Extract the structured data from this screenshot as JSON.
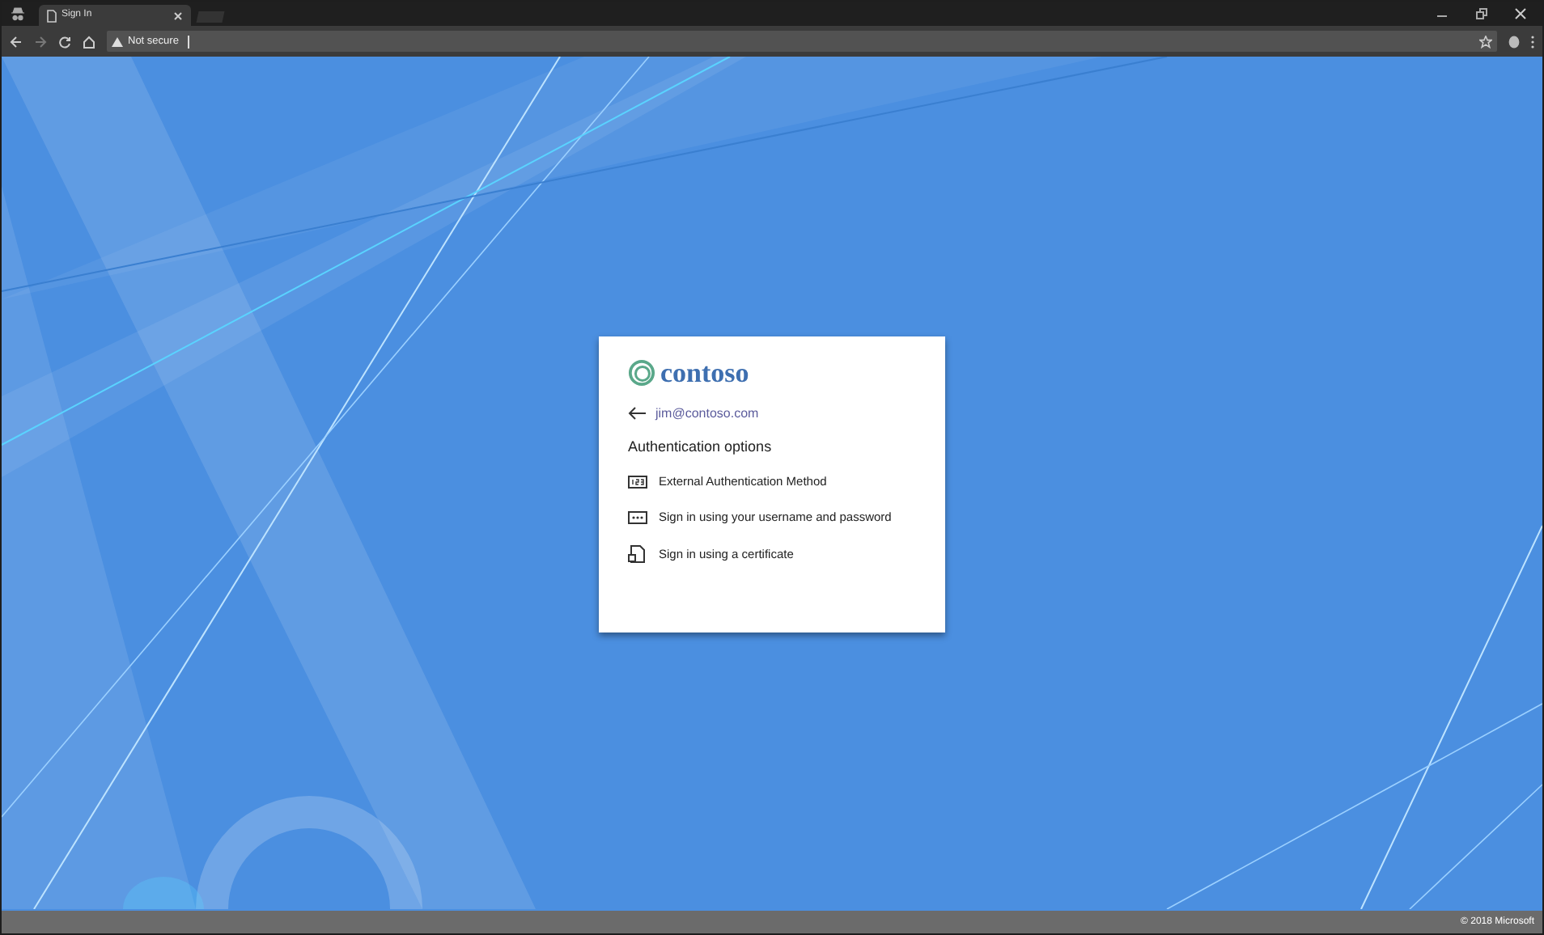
{
  "browser": {
    "tab_title": "Sign In",
    "address": "Not secure"
  },
  "card": {
    "logo_text": "contoso",
    "account": "jim@contoso.com",
    "heading": "Authentication options",
    "options": [
      {
        "kind": "external",
        "label": "External Authentication Method"
      },
      {
        "kind": "password",
        "label": "Sign in using your username and password"
      },
      {
        "kind": "certificate",
        "label": "Sign in using a certificate"
      }
    ]
  },
  "footer": {
    "copyright": "© 2018 Microsoft"
  }
}
